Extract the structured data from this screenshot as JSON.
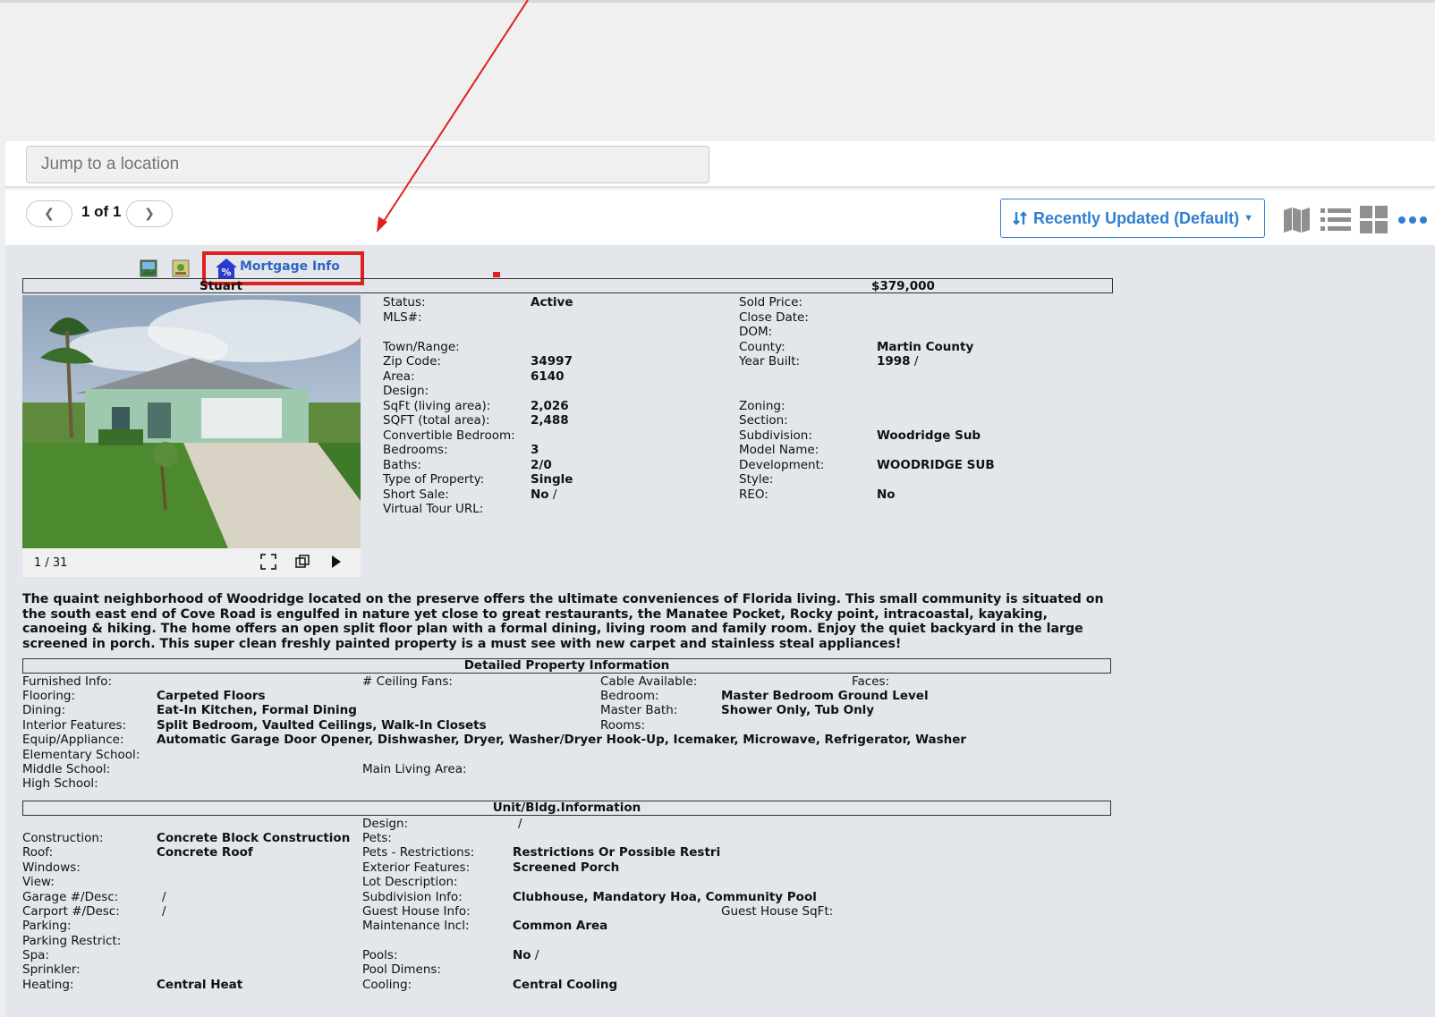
{
  "search": {
    "placeholder": "Jump to a location"
  },
  "pager": {
    "text": "1 of 1",
    "prev": "❮",
    "next": "❯"
  },
  "sort": {
    "label": "Recently Updated (Default)"
  },
  "listing": {
    "mortgage_link": "Mortgage Info",
    "city": "Stuart",
    "price": "$379,000",
    "photo_counter": "1 / 31",
    "left_fields": [
      {
        "label": "Status:",
        "value": "Active"
      },
      {
        "label": "MLS#:",
        "value": ""
      },
      {
        "label": "",
        "value": ""
      },
      {
        "label": "Town/Range:",
        "value": ""
      },
      {
        "label": "Zip Code:",
        "value": "34997"
      },
      {
        "label": "Area:",
        "value": "6140"
      },
      {
        "label": "Design:",
        "value": ""
      },
      {
        "label": "SqFt (living area):",
        "value": "2,026"
      },
      {
        "label": "SQFT (total area):",
        "value": "2,488"
      },
      {
        "label": "Convertible Bedroom:",
        "value": ""
      },
      {
        "label": "Bedrooms:",
        "value": "3"
      },
      {
        "label": "Baths:",
        "value": "2/0"
      },
      {
        "label": "Type of Property:",
        "value": "Single"
      },
      {
        "label": "Short Sale:",
        "value": "No",
        "suffix": " /"
      },
      {
        "label": "Virtual Tour URL:",
        "value": ""
      }
    ],
    "right_fields": [
      {
        "label": "Sold Price:",
        "value": ""
      },
      {
        "label": "Close Date:",
        "value": ""
      },
      {
        "label": "DOM:",
        "value": ""
      },
      {
        "label": "County:",
        "value": "Martin County"
      },
      {
        "label": "Year Built:",
        "value": "1998",
        "suffix": " /"
      },
      {
        "label": "",
        "value": ""
      },
      {
        "label": "",
        "value": ""
      },
      {
        "label": "Zoning:",
        "value": ""
      },
      {
        "label": "Section:",
        "value": ""
      },
      {
        "label": "Subdivision:",
        "value": "Woodridge Sub"
      },
      {
        "label": "Model Name:",
        "value": ""
      },
      {
        "label": "Development:",
        "value": "WOODRIDGE SUB"
      },
      {
        "label": "Style:",
        "value": ""
      },
      {
        "label": "REO:",
        "value": "No"
      }
    ],
    "description": "The quaint neighborhood of Woodridge located on the preserve offers the ultimate conveniences of Florida living. This small community is situated on the south east end of Cove Road is engulfed in nature yet close to great restaurants, the Manatee Pocket, Rocky point, intracoastal, kayaking, canoeing & hiking. The home offers an open split floor plan with a formal dining, living room and family room. Enjoy the quiet backyard in the large screened in porch. This super clean freshly painted property is a must see with new carpet and stainless steal appliances!"
  },
  "detailed": {
    "header": "Detailed Property Information",
    "furnished_label": "Furnished Info:",
    "ceiling_fans_label": "# Ceiling Fans:",
    "cable_label": "Cable Available:",
    "faces_label": "Faces:",
    "flooring_label": "Flooring:",
    "flooring_value": "Carpeted Floors",
    "bedroom_label": "Bedroom:",
    "bedroom_value": "Master Bedroom Ground Level",
    "dining_label": "Dining:",
    "dining_value": "Eat-In Kitchen, Formal Dining",
    "master_bath_label": "Master Bath:",
    "master_bath_value": "Shower Only, Tub Only",
    "interior_label": "Interior Features:",
    "interior_value": "Split Bedroom, Vaulted Ceilings, Walk-In Closets",
    "rooms_label": "Rooms:",
    "equip_label": "Equip/Appliance:",
    "equip_value": "Automatic Garage Door Opener, Dishwasher, Dryer, Washer/Dryer Hook-Up, Icemaker, Microwave, Refrigerator, Washer",
    "elementary_label": "Elementary School:",
    "middle_label": "Middle School:",
    "main_living_label": "Main Living Area:",
    "high_label": "High School:"
  },
  "unit": {
    "header": "Unit/Bldg.Information",
    "design_label": "Design:",
    "design_value": "/",
    "construction_label": "Construction:",
    "construction_value": "Concrete Block Construction",
    "pets_label": "Pets:",
    "roof_label": "Roof:",
    "roof_value": "Concrete Roof",
    "pets_restr_label": "Pets - Restrictions:",
    "pets_restr_value": "Restrictions Or Possible Restri",
    "windows_label": "Windows:",
    "exterior_label": "Exterior Features:",
    "exterior_value": "Screened Porch",
    "view_label": "View:",
    "lot_label": "Lot Description:",
    "garage_label": "Garage #/Desc:",
    "garage_value": "/",
    "subdiv_info_label": "Subdivision Info:",
    "subdiv_info_value": "Clubhouse, Mandatory Hoa, Community Pool",
    "carport_label": "Carport #/Desc:",
    "carport_value": "/",
    "guest_house_label": "Guest House Info:",
    "guest_sqft_label": "Guest House SqFt:",
    "parking_label": "Parking:",
    "maintenance_label": "Maintenance Incl:",
    "maintenance_value": "Common Area",
    "parking_restrict_label": "Parking Restrict:",
    "spa_label": "Spa:",
    "pools_label": "Pools:",
    "pools_value": "No",
    "pools_suffix": " /",
    "sprinkler_label": "Sprinkler:",
    "pool_dim_label": "Pool Dimens:",
    "heating_label": "Heating:",
    "heating_value": "Central Heat",
    "cooling_label": "Cooling:",
    "cooling_value": "Central Cooling"
  },
  "colors": {
    "accent": "#2f7fd1",
    "annotation": "#e02020"
  }
}
